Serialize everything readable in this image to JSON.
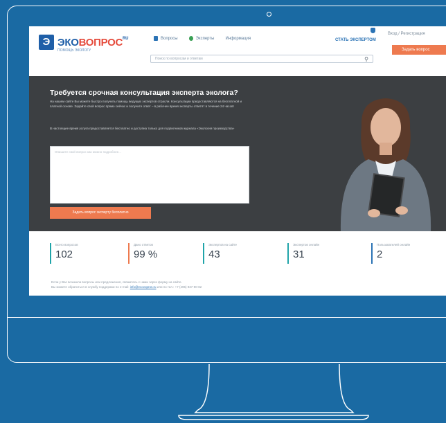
{
  "header": {
    "logo_mark": "Э",
    "logo_name_blue": "ЭКО",
    "logo_name_red": "ВОПРОС",
    "logo_sup": "RU",
    "logo_tagline": "ПОМОЩЬ ЭКОЛОГУ",
    "nav": [
      {
        "label": "Вопросы",
        "icon": "question-icon"
      },
      {
        "label": "Эксперты",
        "icon": "expert-icon"
      },
      {
        "label": "Информация",
        "icon": "info-icon"
      }
    ],
    "experts_link": "СТАТЬ ЭКСПЕРТОМ",
    "login": "Вход / Регистрация",
    "ask_button": "Задать вопрос",
    "search_placeholder": "Поиск по вопросам и ответам"
  },
  "hero": {
    "title": "Требуется срочная консультация эксперта эколога?",
    "text": "На нашем сайте Вы можете быстро получить помощь ведущих экспертов отрасли. Консультации предоставляются на бесплатной и платной основе. Задайте свой вопрос прямо сейчас и получите ответ – в рабочее время эксперты ответят в течение 24 часов!",
    "note": "В настоящее время услуга предоставляется бесплатно и доступна только для подписчиков журнала «Экология производства»",
    "question_placeholder": "Опишите свой вопрос как можно подробнее...",
    "submit_button": "Задать вопрос эксперту бесплатно"
  },
  "stats": [
    {
      "label": "Всего вопросов",
      "value": "102",
      "accent": "#1fa4a9"
    },
    {
      "label": "Дано ответов",
      "value": "99 %",
      "accent": "#ee7a4f"
    },
    {
      "label": "Экспертов на сайте",
      "value": "43",
      "accent": "#1fa4a9"
    },
    {
      "label": "Экспертов онлайн",
      "value": "31",
      "accent": "#1fa4a9"
    },
    {
      "label": "Пользователей онлайн",
      "value": "2",
      "accent": "#2b73b5"
    }
  ],
  "footer": {
    "line1": "Если у Вас возникли вопросы или предложения, свяжитесь с нами через форму на сайте.",
    "line2_prefix": "Вы можете обратиться в службу поддержки по e-mail:",
    "line2_link": "info@ecovopros.ru",
    "line2_suffix": "или по тел.: +7 (495) 937-90-82"
  },
  "colors": {
    "background": "#1a6aa3",
    "accent_orange": "#ee7a4f",
    "brand_blue": "#1f5fa8",
    "hero_dark": "#3c3f42"
  }
}
